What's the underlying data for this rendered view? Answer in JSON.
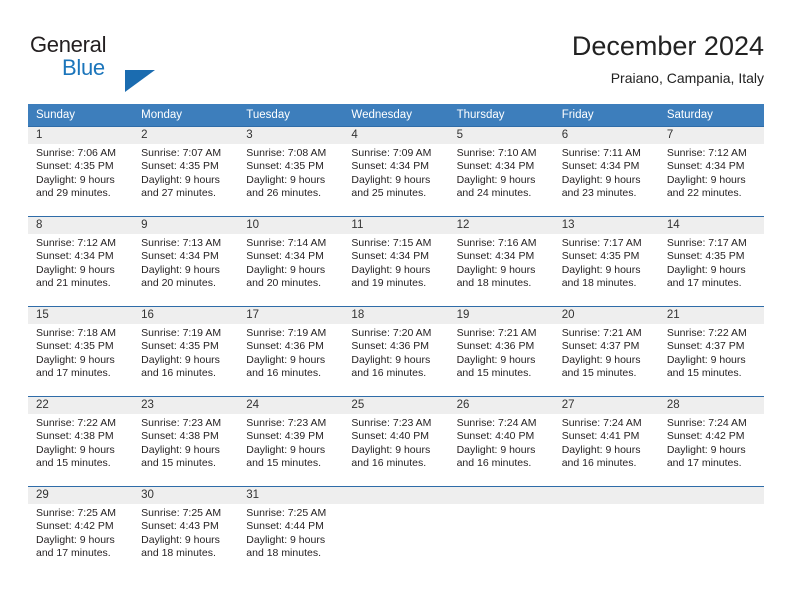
{
  "logo": {
    "word_one": "General",
    "word_two": "Blue",
    "triangle_color": "#1b6cb0",
    "blue_color": "#1b75bb"
  },
  "header": {
    "title": "December 2024",
    "subtitle": "Praiano, Campania, Italy"
  },
  "theme": {
    "header_bg": "#3d7ebc",
    "row_divider": "#2f6ca8",
    "daynum_band": "#eeeeee"
  },
  "weekdays": [
    "Sunday",
    "Monday",
    "Tuesday",
    "Wednesday",
    "Thursday",
    "Friday",
    "Saturday"
  ],
  "weeks": [
    [
      {
        "day": "1",
        "sunrise": "Sunrise: 7:06 AM",
        "sunset": "Sunset: 4:35 PM",
        "daylight1": "Daylight: 9 hours",
        "daylight2": "and 29 minutes."
      },
      {
        "day": "2",
        "sunrise": "Sunrise: 7:07 AM",
        "sunset": "Sunset: 4:35 PM",
        "daylight1": "Daylight: 9 hours",
        "daylight2": "and 27 minutes."
      },
      {
        "day": "3",
        "sunrise": "Sunrise: 7:08 AM",
        "sunset": "Sunset: 4:35 PM",
        "daylight1": "Daylight: 9 hours",
        "daylight2": "and 26 minutes."
      },
      {
        "day": "4",
        "sunrise": "Sunrise: 7:09 AM",
        "sunset": "Sunset: 4:34 PM",
        "daylight1": "Daylight: 9 hours",
        "daylight2": "and 25 minutes."
      },
      {
        "day": "5",
        "sunrise": "Sunrise: 7:10 AM",
        "sunset": "Sunset: 4:34 PM",
        "daylight1": "Daylight: 9 hours",
        "daylight2": "and 24 minutes."
      },
      {
        "day": "6",
        "sunrise": "Sunrise: 7:11 AM",
        "sunset": "Sunset: 4:34 PM",
        "daylight1": "Daylight: 9 hours",
        "daylight2": "and 23 minutes."
      },
      {
        "day": "7",
        "sunrise": "Sunrise: 7:12 AM",
        "sunset": "Sunset: 4:34 PM",
        "daylight1": "Daylight: 9 hours",
        "daylight2": "and 22 minutes."
      }
    ],
    [
      {
        "day": "8",
        "sunrise": "Sunrise: 7:12 AM",
        "sunset": "Sunset: 4:34 PM",
        "daylight1": "Daylight: 9 hours",
        "daylight2": "and 21 minutes."
      },
      {
        "day": "9",
        "sunrise": "Sunrise: 7:13 AM",
        "sunset": "Sunset: 4:34 PM",
        "daylight1": "Daylight: 9 hours",
        "daylight2": "and 20 minutes."
      },
      {
        "day": "10",
        "sunrise": "Sunrise: 7:14 AM",
        "sunset": "Sunset: 4:34 PM",
        "daylight1": "Daylight: 9 hours",
        "daylight2": "and 20 minutes."
      },
      {
        "day": "11",
        "sunrise": "Sunrise: 7:15 AM",
        "sunset": "Sunset: 4:34 PM",
        "daylight1": "Daylight: 9 hours",
        "daylight2": "and 19 minutes."
      },
      {
        "day": "12",
        "sunrise": "Sunrise: 7:16 AM",
        "sunset": "Sunset: 4:34 PM",
        "daylight1": "Daylight: 9 hours",
        "daylight2": "and 18 minutes."
      },
      {
        "day": "13",
        "sunrise": "Sunrise: 7:17 AM",
        "sunset": "Sunset: 4:35 PM",
        "daylight1": "Daylight: 9 hours",
        "daylight2": "and 18 minutes."
      },
      {
        "day": "14",
        "sunrise": "Sunrise: 7:17 AM",
        "sunset": "Sunset: 4:35 PM",
        "daylight1": "Daylight: 9 hours",
        "daylight2": "and 17 minutes."
      }
    ],
    [
      {
        "day": "15",
        "sunrise": "Sunrise: 7:18 AM",
        "sunset": "Sunset: 4:35 PM",
        "daylight1": "Daylight: 9 hours",
        "daylight2": "and 17 minutes."
      },
      {
        "day": "16",
        "sunrise": "Sunrise: 7:19 AM",
        "sunset": "Sunset: 4:35 PM",
        "daylight1": "Daylight: 9 hours",
        "daylight2": "and 16 minutes."
      },
      {
        "day": "17",
        "sunrise": "Sunrise: 7:19 AM",
        "sunset": "Sunset: 4:36 PM",
        "daylight1": "Daylight: 9 hours",
        "daylight2": "and 16 minutes."
      },
      {
        "day": "18",
        "sunrise": "Sunrise: 7:20 AM",
        "sunset": "Sunset: 4:36 PM",
        "daylight1": "Daylight: 9 hours",
        "daylight2": "and 16 minutes."
      },
      {
        "day": "19",
        "sunrise": "Sunrise: 7:21 AM",
        "sunset": "Sunset: 4:36 PM",
        "daylight1": "Daylight: 9 hours",
        "daylight2": "and 15 minutes."
      },
      {
        "day": "20",
        "sunrise": "Sunrise: 7:21 AM",
        "sunset": "Sunset: 4:37 PM",
        "daylight1": "Daylight: 9 hours",
        "daylight2": "and 15 minutes."
      },
      {
        "day": "21",
        "sunrise": "Sunrise: 7:22 AM",
        "sunset": "Sunset: 4:37 PM",
        "daylight1": "Daylight: 9 hours",
        "daylight2": "and 15 minutes."
      }
    ],
    [
      {
        "day": "22",
        "sunrise": "Sunrise: 7:22 AM",
        "sunset": "Sunset: 4:38 PM",
        "daylight1": "Daylight: 9 hours",
        "daylight2": "and 15 minutes."
      },
      {
        "day": "23",
        "sunrise": "Sunrise: 7:23 AM",
        "sunset": "Sunset: 4:38 PM",
        "daylight1": "Daylight: 9 hours",
        "daylight2": "and 15 minutes."
      },
      {
        "day": "24",
        "sunrise": "Sunrise: 7:23 AM",
        "sunset": "Sunset: 4:39 PM",
        "daylight1": "Daylight: 9 hours",
        "daylight2": "and 15 minutes."
      },
      {
        "day": "25",
        "sunrise": "Sunrise: 7:23 AM",
        "sunset": "Sunset: 4:40 PM",
        "daylight1": "Daylight: 9 hours",
        "daylight2": "and 16 minutes."
      },
      {
        "day": "26",
        "sunrise": "Sunrise: 7:24 AM",
        "sunset": "Sunset: 4:40 PM",
        "daylight1": "Daylight: 9 hours",
        "daylight2": "and 16 minutes."
      },
      {
        "day": "27",
        "sunrise": "Sunrise: 7:24 AM",
        "sunset": "Sunset: 4:41 PM",
        "daylight1": "Daylight: 9 hours",
        "daylight2": "and 16 minutes."
      },
      {
        "day": "28",
        "sunrise": "Sunrise: 7:24 AM",
        "sunset": "Sunset: 4:42 PM",
        "daylight1": "Daylight: 9 hours",
        "daylight2": "and 17 minutes."
      }
    ],
    [
      {
        "day": "29",
        "sunrise": "Sunrise: 7:25 AM",
        "sunset": "Sunset: 4:42 PM",
        "daylight1": "Daylight: 9 hours",
        "daylight2": "and 17 minutes."
      },
      {
        "day": "30",
        "sunrise": "Sunrise: 7:25 AM",
        "sunset": "Sunset: 4:43 PM",
        "daylight1": "Daylight: 9 hours",
        "daylight2": "and 18 minutes."
      },
      {
        "day": "31",
        "sunrise": "Sunrise: 7:25 AM",
        "sunset": "Sunset: 4:44 PM",
        "daylight1": "Daylight: 9 hours",
        "daylight2": "and 18 minutes."
      },
      {
        "day": "",
        "sunrise": "",
        "sunset": "",
        "daylight1": "",
        "daylight2": ""
      },
      {
        "day": "",
        "sunrise": "",
        "sunset": "",
        "daylight1": "",
        "daylight2": ""
      },
      {
        "day": "",
        "sunrise": "",
        "sunset": "",
        "daylight1": "",
        "daylight2": ""
      },
      {
        "day": "",
        "sunrise": "",
        "sunset": "",
        "daylight1": "",
        "daylight2": ""
      }
    ]
  ]
}
